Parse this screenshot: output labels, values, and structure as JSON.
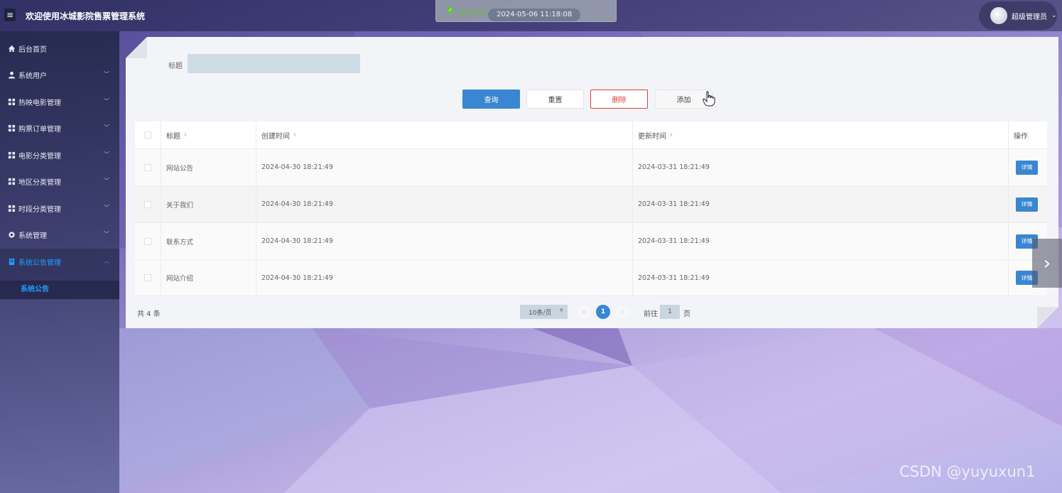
{
  "header": {
    "menu_icon": "menu-icon",
    "title": "欢迎使用冰城影院售票管理系统",
    "user_name": "超级管理员",
    "user_caret": "⌄"
  },
  "toast": {
    "message": "提交成功",
    "time": "2024-05-06 11:18:08"
  },
  "sidebar": {
    "items": [
      {
        "label": "后台首页",
        "icon": "home-icon",
        "has_arrow": false
      },
      {
        "label": "系统用户",
        "icon": "user-icon",
        "has_arrow": true
      },
      {
        "label": "热映电影管理",
        "icon": "grid-icon",
        "has_arrow": true
      },
      {
        "label": "购票订单管理",
        "icon": "grid-icon",
        "has_arrow": true
      },
      {
        "label": "电影分类管理",
        "icon": "grid-icon",
        "has_arrow": true
      },
      {
        "label": "地区分类管理",
        "icon": "grid-icon",
        "has_arrow": true
      },
      {
        "label": "时段分类管理",
        "icon": "grid-icon",
        "has_arrow": true
      },
      {
        "label": "系统管理",
        "icon": "gear-icon",
        "has_arrow": true
      },
      {
        "label": "系统公告管理",
        "icon": "document-icon",
        "has_arrow": true,
        "active": true
      }
    ],
    "sub_item": "系统公告",
    "accent": "#1f9fff"
  },
  "search": {
    "label": "标题",
    "value": "",
    "placeholder": ""
  },
  "toolbar": {
    "query_label": "查询",
    "reset_label": "重置",
    "delete_label": "删除",
    "add_label": "添加"
  },
  "table": {
    "columns": [
      "标题",
      "创建时间",
      "更新时间",
      "操作"
    ],
    "rows": [
      {
        "title": "网站公告",
        "created": "2024-04-30 18:21:49",
        "updated": "2024-03-31 18:21:49",
        "action": "详情"
      },
      {
        "title": "关于我们",
        "created": "2024-04-30 18:21:49",
        "updated": "2024-03-31 18:21:49",
        "action": "详情"
      },
      {
        "title": "联系方式",
        "created": "2024-04-30 18:21:49",
        "updated": "2024-03-31 18:21:49",
        "action": "详情"
      },
      {
        "title": "网站介绍",
        "created": "2024-04-30 18:21:49",
        "updated": "2024-03-31 18:21:49",
        "action": "详情"
      }
    ]
  },
  "pagination": {
    "total_text": "共 4 条",
    "page_size": "10条/页",
    "current_page": "1",
    "prev": "‹",
    "next": "›",
    "goto_label": "前往",
    "goto_value": "1",
    "goto_suffix": "页"
  },
  "carousel": {
    "next_label": "›"
  },
  "watermark": "CSDN @yuyuxun1",
  "colors": {
    "primary": "#3a86d0",
    "danger": "#e03a3a",
    "success": "#67c23a"
  }
}
